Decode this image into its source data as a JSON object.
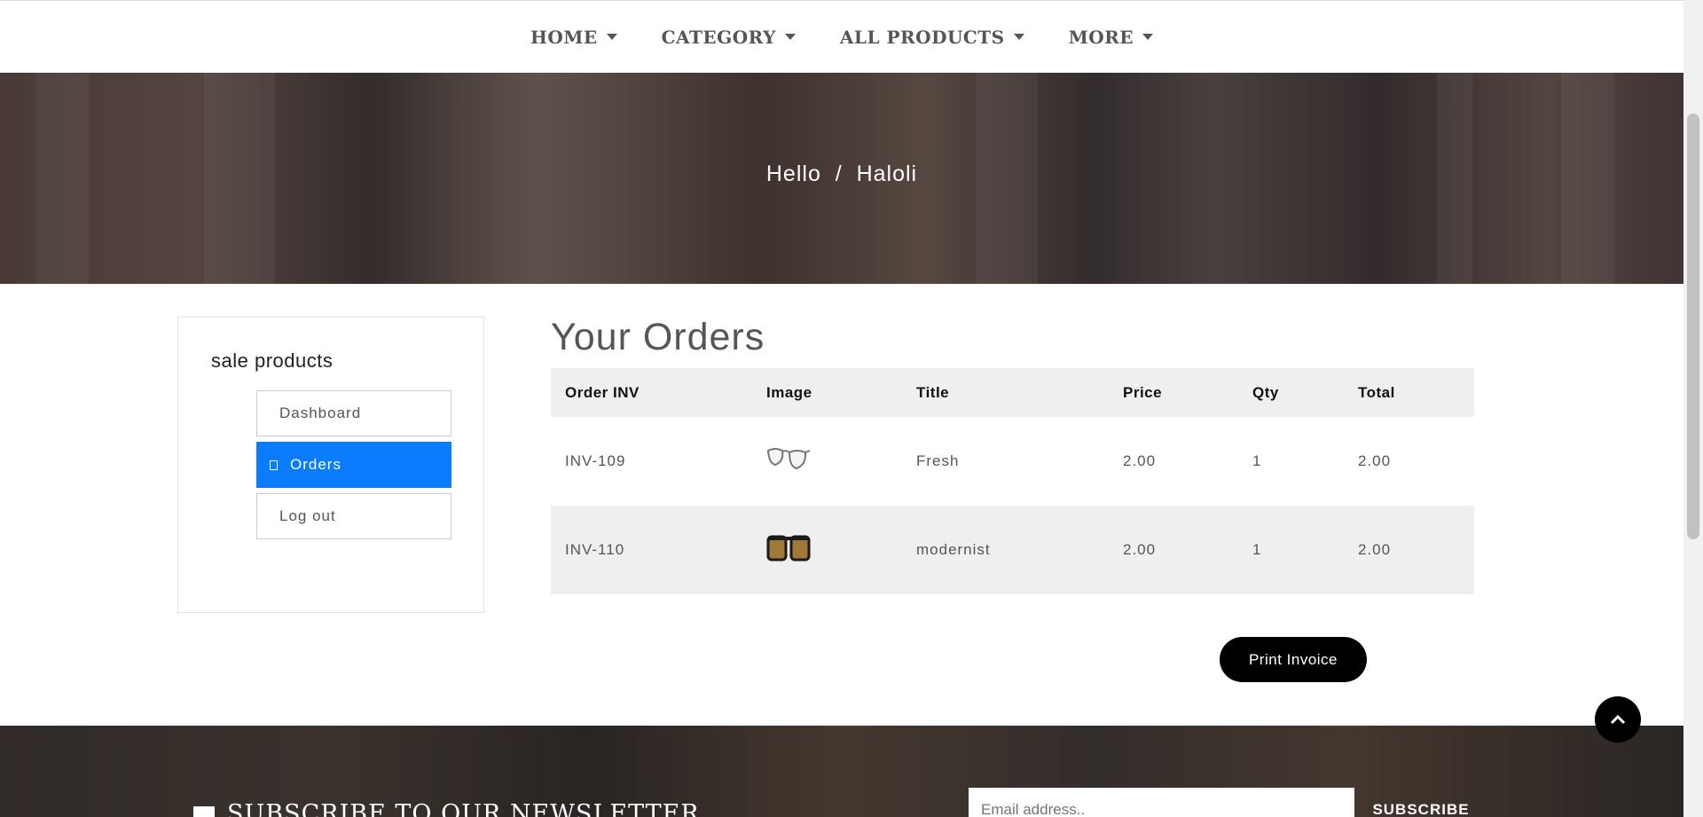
{
  "nav": {
    "items": [
      {
        "label": "HOME"
      },
      {
        "label": "CATEGORY"
      },
      {
        "label": "ALL PRODUCTS"
      },
      {
        "label": "MORE"
      }
    ]
  },
  "hero": {
    "title": "Hello  /  Haloli"
  },
  "sidebar": {
    "title": "sale products",
    "items": [
      {
        "label": "Dashboard"
      },
      {
        "label": "Orders"
      },
      {
        "label": "Log out"
      }
    ],
    "active_index": 1,
    "accent_color": "#0a7cff"
  },
  "orders": {
    "title": "Your Orders",
    "columns": [
      "Order INV",
      "Image",
      "Title",
      "Price",
      "Qty",
      "Total"
    ],
    "rows": [
      {
        "inv": "INV-109",
        "image": "clear-glasses-icon",
        "title": "Fresh",
        "price": "2.00",
        "qty": "1",
        "total": "2.00"
      },
      {
        "inv": "INV-110",
        "image": "tinted-sunglasses-icon",
        "title": "modernist",
        "price": "2.00",
        "qty": "1",
        "total": "2.00"
      }
    ]
  },
  "print_button": "Print Invoice",
  "footer": {
    "newsletter_title": "SUBSCRIBE TO OUR NEWSLETTER",
    "email_placeholder": "Email address..",
    "subscribe_label": "SUBSCRIBE"
  }
}
